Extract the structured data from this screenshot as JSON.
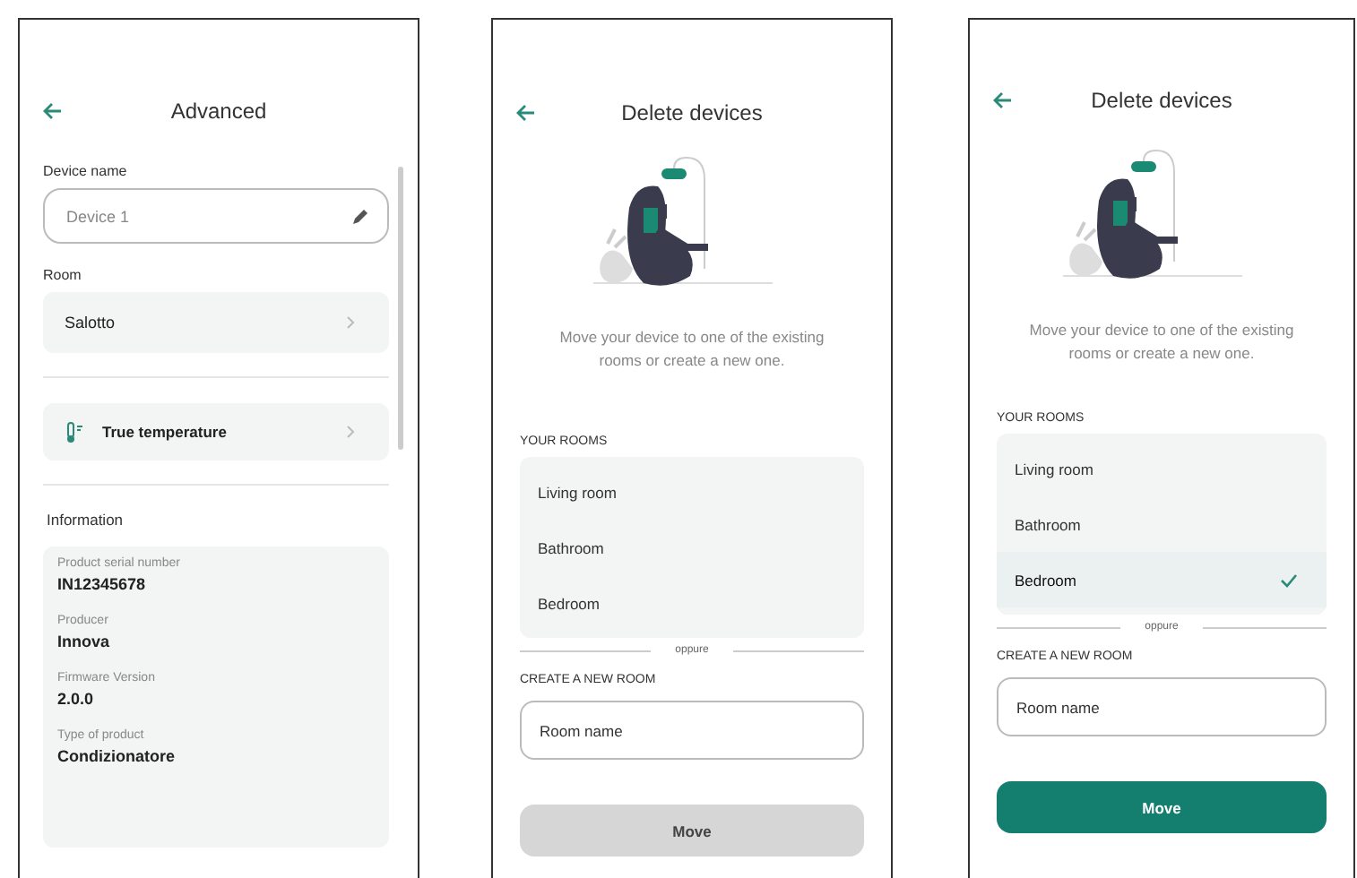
{
  "screens": [
    {
      "kind": "advanced",
      "title": "Advanced",
      "device_name": {
        "label": "Device name",
        "placeholder": "Device 1"
      },
      "room": {
        "label": "Room",
        "value": "Salotto"
      },
      "true_temperature": {
        "label": "True temperature"
      },
      "information": {
        "heading": "Information",
        "fields": [
          {
            "label": "Product serial number",
            "value": "IN12345678"
          },
          {
            "label": "Producer",
            "value": "Innova"
          },
          {
            "label": "Firmware Version",
            "value": "2.0.0"
          },
          {
            "label": "Type of product",
            "value": "Condizionatore"
          }
        ]
      }
    },
    {
      "kind": "move",
      "title": "Delete devices",
      "message": "Move your device to one of the existing rooms or create a new one.",
      "rooms_heading": "YOUR ROOMS",
      "rooms": [
        {
          "label": "Living room",
          "selected": false
        },
        {
          "label": "Bathroom",
          "selected": false
        },
        {
          "label": "Bedroom",
          "selected": false
        }
      ],
      "divider_label": "oppure",
      "create_heading": "CREATE A NEW ROOM",
      "room_name": {
        "placeholder": "Room name"
      },
      "move_button": {
        "label": "Move",
        "disabled": true
      }
    },
    {
      "kind": "move",
      "title": "Delete devices",
      "message": "Move your device to one of the existing rooms or create a new one.",
      "rooms_heading": "YOUR ROOMS",
      "rooms": [
        {
          "label": "Living room",
          "selected": false
        },
        {
          "label": "Bathroom",
          "selected": false
        },
        {
          "label": "Bedroom",
          "selected": true
        }
      ],
      "divider_label": "oppure",
      "create_heading": "CREATE A NEW ROOM",
      "room_name": {
        "placeholder": "Room name"
      },
      "move_button": {
        "label": "Move",
        "disabled": false
      }
    }
  ]
}
